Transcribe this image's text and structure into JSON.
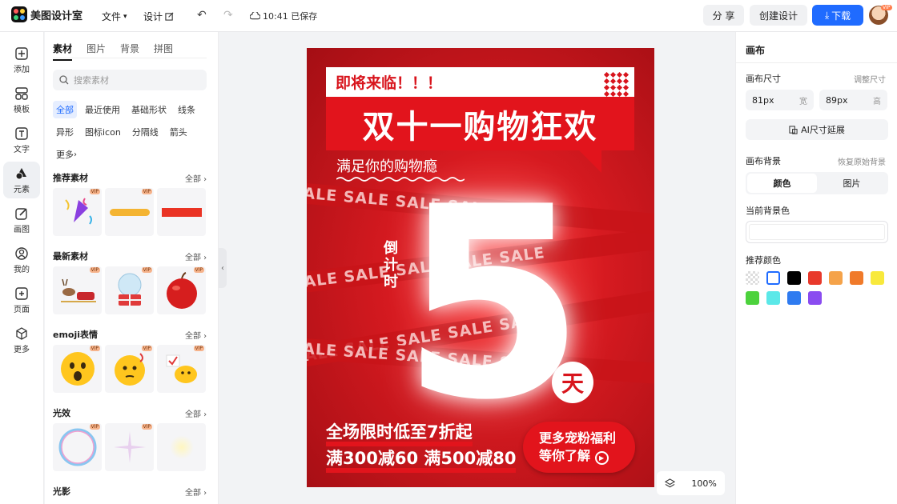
{
  "topbar": {
    "app_name": "美图设计室",
    "menu_file": "文件",
    "menu_design": "设计",
    "save_status": "10:41 已保存",
    "share_label": "分 享",
    "create_label": "创建设计",
    "download_label": "下载",
    "avatar_badge": "VIP"
  },
  "rail": {
    "items": [
      {
        "label": "添加",
        "icon": "plus-square-icon"
      },
      {
        "label": "模板",
        "icon": "template-icon"
      },
      {
        "label": "文字",
        "icon": "text-icon"
      },
      {
        "label": "元素",
        "icon": "shapes-icon"
      },
      {
        "label": "画图",
        "icon": "draw-icon"
      },
      {
        "label": "我的",
        "icon": "user-icon"
      },
      {
        "label": "页面",
        "icon": "page-add-icon"
      },
      {
        "label": "更多",
        "icon": "cube-icon"
      }
    ],
    "active_index": 3
  },
  "panel": {
    "tabs": [
      "素材",
      "图片",
      "背景",
      "拼图"
    ],
    "search_placeholder": "搜索素材",
    "chips": [
      "全部",
      "最近使用",
      "基础形状",
      "线条",
      "异形",
      "图标icon",
      "分隔线",
      "箭头",
      "更多"
    ],
    "vip": "VIP",
    "sections": [
      {
        "title": "推荐素材",
        "all": "全部"
      },
      {
        "title": "最新素材",
        "all": "全部"
      },
      {
        "title": "emoji表情",
        "all": "全部"
      },
      {
        "title": "光效",
        "all": "全部"
      },
      {
        "title": "光影",
        "all": "全部"
      }
    ]
  },
  "poster": {
    "top_banner": "即将来临！！！",
    "title": "双十一购物狂欢",
    "subtitle": "满足你的购物瘾",
    "ribbon_text": "SALE SALE SALE SALE SALE",
    "countdown_label": "倒计时",
    "big_number": "5",
    "day": "天",
    "promo_line1": "全场限时低至7折起",
    "promo_line2": "满300减60 满500减80",
    "cta_line1": "更多宠粉福利",
    "cta_line2": "等你了解"
  },
  "zoom": {
    "level": "100%"
  },
  "right_panel": {
    "title": "画布",
    "size_label": "画布尺寸",
    "adjust_link": "调整尺寸",
    "width_value": "81px",
    "width_unit": "宽",
    "height_value": "89px",
    "height_unit": "高",
    "ai_extend": "AI尺寸延展",
    "bg_label": "画布背景",
    "restore_link": "恢复原始背景",
    "seg_color": "颜色",
    "seg_image": "图片",
    "current_color_label": "当前背景色",
    "recommend_label": "推荐颜色",
    "swatches": [
      "transparent",
      "#ffffff",
      "#000000",
      "#e8392b",
      "#f5a34a",
      "#f07a2a",
      "#f8e93c",
      "#4cd23c",
      "#5be8e8",
      "#2f7bf0",
      "#8a4cf0"
    ]
  }
}
